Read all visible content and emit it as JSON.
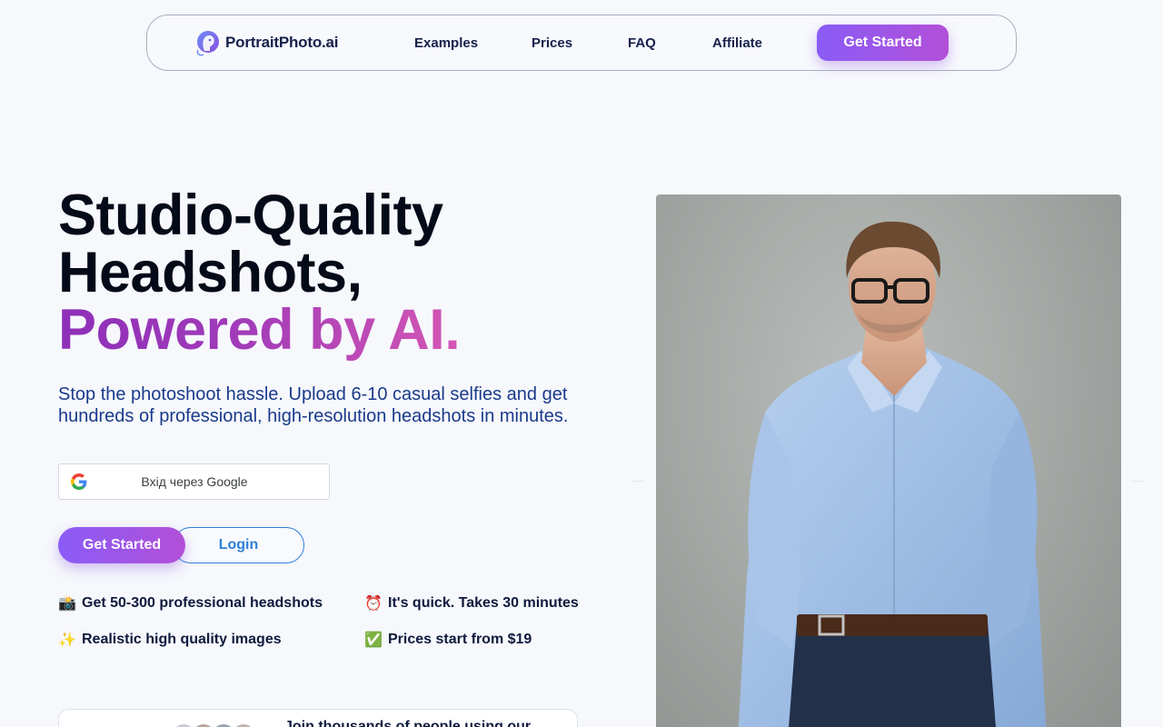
{
  "brand": {
    "name": "PortraitPhoto.ai",
    "accent": "#8a5cf6",
    "accent_end": "#b24fd8"
  },
  "nav": {
    "links": [
      "Examples",
      "Prices",
      "FAQ",
      "Affiliate"
    ],
    "cta": "Get Started"
  },
  "hero": {
    "title_line1": "Studio-Quality",
    "title_line2": "Headshots,",
    "title_line3": "Powered by AI.",
    "subtitle": "Stop the photoshoot hassle. Upload 6-10 casual selfies and get hundreds of professional, high-resolution headshots in minutes.",
    "google_button": "Вхід через Google",
    "cta_primary": "Get Started",
    "cta_secondary": "Login"
  },
  "features": [
    {
      "icon": "camera-flash-icon",
      "emoji": "📸",
      "text": "Get 50-300 professional headshots"
    },
    {
      "icon": "alarm-clock-icon",
      "emoji": "⏰",
      "text": "It's quick. Takes 30 minutes"
    },
    {
      "icon": "sparkles-icon",
      "emoji": "✨",
      "text": "Realistic high quality images"
    },
    {
      "icon": "check-mark-icon",
      "emoji": "✅",
      "text": "Prices start from $19"
    }
  ],
  "social_proof": {
    "text": "Join thousands of people using our"
  }
}
